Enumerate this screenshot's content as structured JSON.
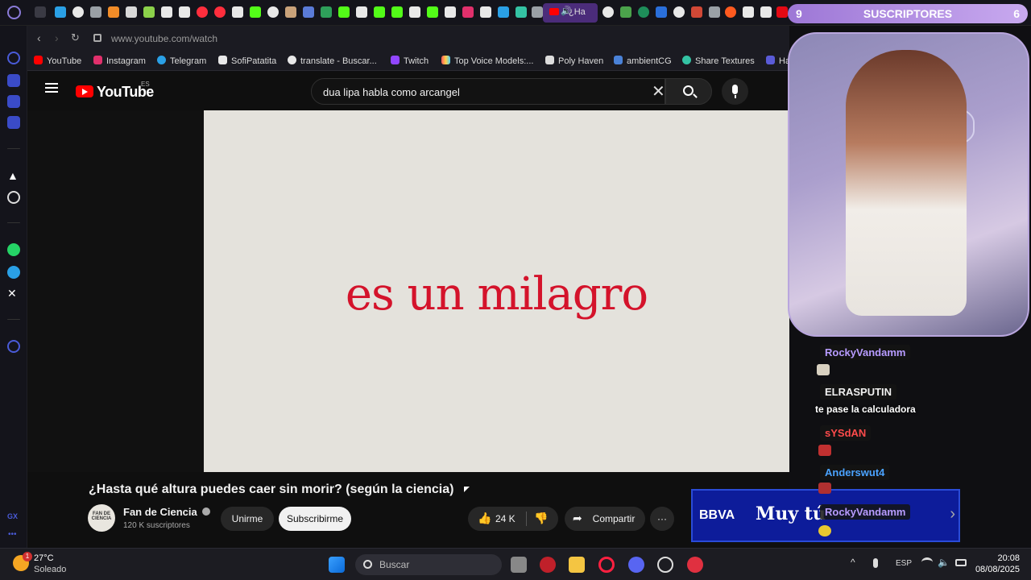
{
  "browser": {
    "url": "www.youtube.com/watch",
    "active_tab_label": "¿Ha",
    "bookmarks": [
      "YouTube",
      "Instagram",
      "Telegram",
      "SofiPatatita",
      "translate - Buscar...",
      "Twitch",
      "Top Voice Models:...",
      "Poly Haven",
      "ambientCG",
      "Share Textures",
      "Har"
    ]
  },
  "youtube": {
    "logo_text": "YouTube",
    "region": "ES",
    "search_query": "dua lipa habla como arcangel",
    "video_caption": "es un milagro",
    "video_title": "¿Hasta qué altura puedes caer sin morir? (según la ciencia)",
    "channel_name": "Fan de Ciencia",
    "channel_avatar_text": "FAN DE CIENCIA",
    "subscribers": "120 K suscriptores",
    "join_label": "Unirme",
    "subscribe_label": "Subscribirme",
    "likes": "24 K",
    "share_label": "Compartir",
    "more_label": "···"
  },
  "sponsor": {
    "brand": "BBVA",
    "text": "Muy tú"
  },
  "stream_overlay": {
    "goal_current": "9",
    "goal_label": "SUSCRIPTORES",
    "goal_target": "6",
    "chat": [
      {
        "user": "RockyVandamm",
        "message": "",
        "color": "#b89cff"
      },
      {
        "user": "ELRASPUTIN",
        "message": "te pase la calculadora",
        "color": "#f0f0f0"
      },
      {
        "user": "sYSdAN",
        "message": "",
        "color": "#ff4b4b"
      },
      {
        "user": "Anderswut4",
        "message": "",
        "color": "#4ba3ff"
      },
      {
        "user": "RockyVandamm",
        "message": "",
        "color": "#b89cff"
      }
    ]
  },
  "taskbar": {
    "temperature": "27°C",
    "weather": "Soleado",
    "weather_badge": "1",
    "search_placeholder": "Buscar",
    "language": "ESP",
    "time": "20:08",
    "date": "08/08/2025"
  },
  "sidebar_label": "GX",
  "colors": {
    "youtube_red": "#ff0000",
    "caption_red": "#d4132b",
    "goal_purple": "#9d77d6",
    "sponsor_blue": "#0d1c9a"
  }
}
